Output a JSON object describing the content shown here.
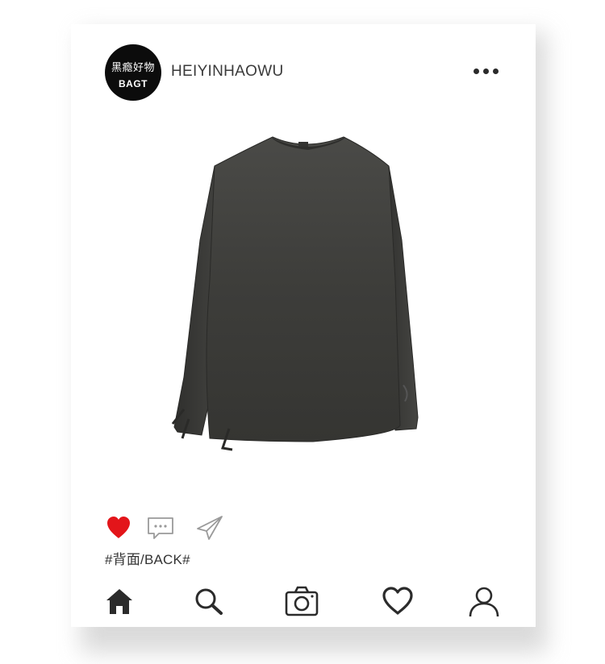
{
  "post": {
    "avatar_line1": "黑瘾好物",
    "avatar_line2": "BAGT",
    "username": "HEIYINHAOWU",
    "image_subject": "dark distressed long-sleeve sweatshirt (back view)",
    "liked": true,
    "caption": "#背面/BACK#"
  },
  "actions": [
    {
      "name": "like",
      "icon": "heart-filled-icon"
    },
    {
      "name": "comment",
      "icon": "comment-bubble-icon"
    },
    {
      "name": "share",
      "icon": "paper-plane-icon"
    }
  ],
  "tabbar": [
    {
      "name": "home",
      "icon": "home-icon"
    },
    {
      "name": "search",
      "icon": "search-icon"
    },
    {
      "name": "camera",
      "icon": "camera-icon"
    },
    {
      "name": "activity",
      "icon": "heart-outline-icon"
    },
    {
      "name": "profile",
      "icon": "profile-icon"
    }
  ],
  "colors": {
    "like_red": "#e3151a",
    "icon_dark": "#2b2b2b",
    "icon_light": "#9a9a9a",
    "garment": "#3f3f3c"
  }
}
